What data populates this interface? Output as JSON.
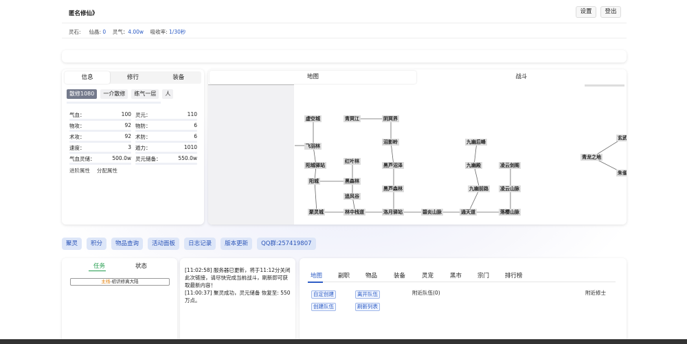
{
  "header": {
    "title": "匿名修仙》",
    "settings_label": "设置",
    "logout_label": "登出",
    "stats": {
      "lingshi_label": "灵石:",
      "xianjing_label": "仙晶:",
      "xianjing_value": "0",
      "lingqi_label": "灵气：",
      "lingqi_value": "4.00w",
      "rate_label": "吸收率:",
      "rate_value": "1/30秒"
    }
  },
  "left_panel": {
    "tabs": [
      "信息",
      "修行",
      "装备"
    ],
    "tags": [
      "散修1080",
      "一介散修",
      "练气一层",
      "人"
    ],
    "attrs": [
      {
        "k1": "气血：",
        "v1": "100",
        "k2": "灵元：",
        "v2": "110"
      },
      {
        "k1": "物攻：",
        "v1": "92",
        "k2": "物防：",
        "v2": "6"
      },
      {
        "k1": "术攻：",
        "v1": "92",
        "k2": "术防：",
        "v2": "6"
      },
      {
        "k1": "速度：",
        "v1": "3",
        "k2": "遁力：",
        "v2": "1010"
      },
      {
        "k1": "气血灵储：",
        "v1": "500.0w",
        "k2": "灵元储备：",
        "v2": "550.0w"
      }
    ],
    "links": [
      "进阶属性",
      "分配属性"
    ]
  },
  "right_panel": {
    "tabs": [
      "地图",
      "战斗"
    ],
    "map_nodes": [
      {
        "id": "xukong",
        "label": "虚空城"
      },
      {
        "id": "qingming",
        "label": "青冥江"
      },
      {
        "id": "yinming",
        "label": "阴冥界"
      },
      {
        "id": "feiyu",
        "label": "飞羽林"
      },
      {
        "id": "zhaoying",
        "label": "沼影岭"
      },
      {
        "id": "jiuyouhou",
        "label": "九幽后峰"
      },
      {
        "id": "xuanwu",
        "label": "玄武"
      },
      {
        "id": "qinglong",
        "label": "青龙之地"
      },
      {
        "id": "yangchengyi",
        "label": "阳城驿站"
      },
      {
        "id": "hongye",
        "label": "红叶林"
      },
      {
        "id": "heiluzhao",
        "label": "黑芦沼泽"
      },
      {
        "id": "jiuyoudian",
        "label": "九幽殿"
      },
      {
        "id": "lingyunjian",
        "label": "凌云剑阁"
      },
      {
        "id": "zhuque",
        "label": "朱雀"
      },
      {
        "id": "yangcheng",
        "label": "阳城"
      },
      {
        "id": "heisen",
        "label": "黑森林"
      },
      {
        "id": "heilusen",
        "label": "黑芦森林"
      },
      {
        "id": "jiuyouqian",
        "label": "九幽前路"
      },
      {
        "id": "lingyunshan",
        "label": "凌云山脉"
      },
      {
        "id": "zhuifeng",
        "label": "追风谷"
      },
      {
        "id": "juling",
        "label": "聚灵城"
      },
      {
        "id": "linzhong",
        "label": "林中栈道"
      },
      {
        "id": "luoyue",
        "label": "洛月驿站"
      },
      {
        "id": "biyan",
        "label": "碧炎山脉"
      },
      {
        "id": "tongtian",
        "label": "通天道"
      },
      {
        "id": "luoying",
        "label": "落樱山脉"
      }
    ]
  },
  "quick_buttons": [
    "聚灵",
    "积分",
    "物品查询",
    "活动面板",
    "日志记录",
    "版本更新",
    "QQ群:257419807"
  ],
  "task_panel": {
    "tabs": [
      "任务",
      "状态"
    ],
    "quest_tag": "主线",
    "quest_text": "-初识修真大陆"
  },
  "log_panel": {
    "entries": [
      "[11:02:58] 服务器已更新，将于11:12分关闭此次链接，请尽快完成当前战斗，刷新即可获取最新内容！",
      "[11:00:37] 聚灵成功，灵元储备 恢复至: 550 万点。"
    ]
  },
  "main_panel": {
    "tabs": [
      "地图",
      "副职",
      "物品",
      "装备",
      "灵宠",
      "黑市",
      "宗门",
      "排行榜"
    ],
    "buttons": [
      "自定创建",
      "离开队伍",
      "创建队伍",
      "刷新列表"
    ],
    "team_label": "附近队伍(0)",
    "nearby_label": "附近修士"
  },
  "colors": {
    "accent": "#2c5cc5",
    "quick_button_bg": "#dde6f8",
    "active_tab_green": "#1e9a4a",
    "node_bg": "#dcdcdc"
  }
}
